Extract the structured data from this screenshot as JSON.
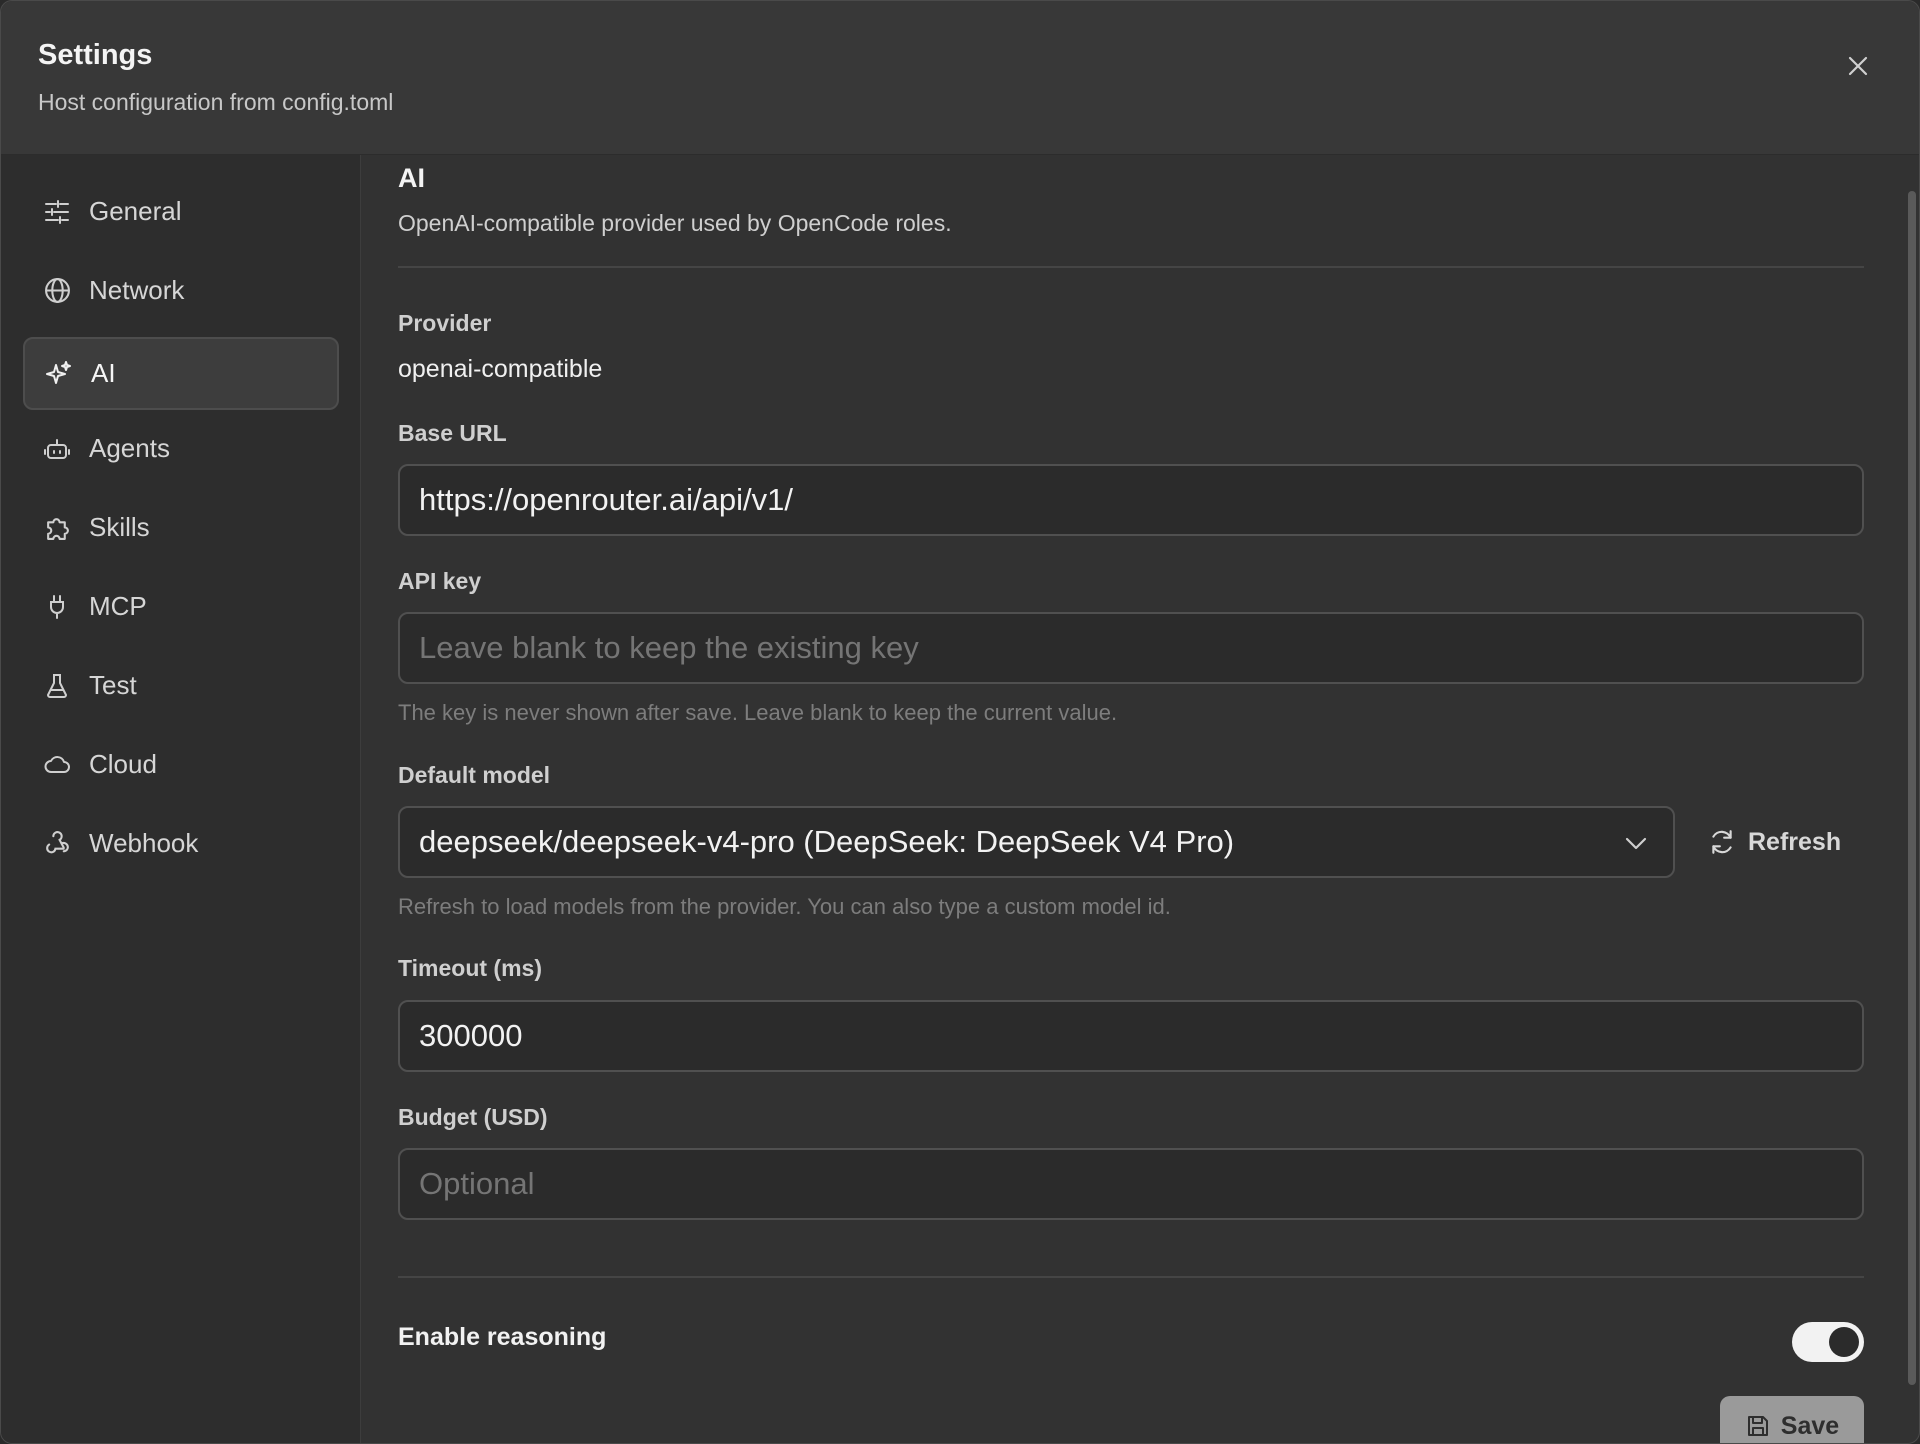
{
  "header": {
    "title": "Settings",
    "subtitle": "Host configuration from config.toml"
  },
  "sidebar": {
    "items": [
      {
        "label": "General",
        "icon": "sliders-icon"
      },
      {
        "label": "Network",
        "icon": "globe-icon"
      },
      {
        "label": "AI",
        "icon": "sparkles-icon",
        "active": true
      },
      {
        "label": "Agents",
        "icon": "bot-icon"
      },
      {
        "label": "Skills",
        "icon": "puzzle-icon"
      },
      {
        "label": "MCP",
        "icon": "plug-icon"
      },
      {
        "label": "Test",
        "icon": "flask-icon"
      },
      {
        "label": "Cloud",
        "icon": "cloud-icon"
      },
      {
        "label": "Webhook",
        "icon": "webhook-icon"
      }
    ]
  },
  "section": {
    "title": "AI",
    "description": "OpenAI-compatible provider used by OpenCode roles."
  },
  "fields": {
    "provider": {
      "label": "Provider",
      "value": "openai-compatible"
    },
    "base_url": {
      "label": "Base URL",
      "value": "https://openrouter.ai/api/v1/"
    },
    "api_key": {
      "label": "API key",
      "value": "",
      "placeholder": "Leave blank to keep the existing key",
      "hint": "The key is never shown after save. Leave blank to keep the current value."
    },
    "default_model": {
      "label": "Default model",
      "value": "deepseek/deepseek-v4-pro (DeepSeek: DeepSeek V4 Pro)",
      "refresh_label": "Refresh",
      "hint": "Refresh to load models from the provider. You can also type a custom model id."
    },
    "timeout": {
      "label": "Timeout (ms)",
      "value": "300000"
    },
    "budget": {
      "label": "Budget (USD)",
      "value": "",
      "placeholder": "Optional"
    },
    "reasoning": {
      "label": "Enable reasoning",
      "enabled": true
    }
  },
  "actions": {
    "save_label": "Save"
  },
  "colors": {
    "background": "#323232",
    "sidebar": "#2d2d2d",
    "active_item": "#3d3d3d",
    "save_button": "#9a9a9a",
    "toggle_on": "#f2f2f2"
  }
}
